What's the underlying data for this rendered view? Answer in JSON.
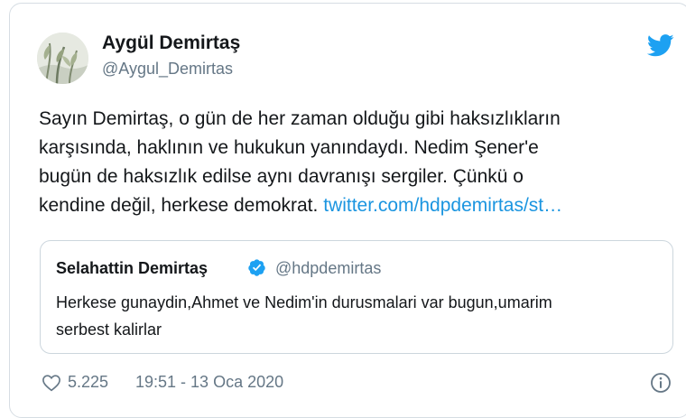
{
  "author": {
    "name": "Aygül Demirtaş",
    "handle": "@Aygul_Demirtas"
  },
  "tweet": {
    "lines": [
      "Sayın Demirtaş, o gün de her zaman olduğu gibi haksızlıkların",
      "karşısında, haklının ve hukukun yanındaydı. Nedim Şener'e",
      "bugün de haksızlık edilse aynı davranışı sergiler. Çünkü o",
      "kendine değil, herkese demokrat. "
    ],
    "link": "twitter.com/hdpdemirtas/st…"
  },
  "quoted_tweet": {
    "name": "Selahattin Demirtaş",
    "handle": "@hdpdemirtas",
    "lines": [
      "Herkese gunaydin,Ahmet ve Nedim'in durusmalari var bugun,umarim",
      "serbest kalirlar"
    ]
  },
  "footer": {
    "likes": "5.225",
    "timestamp": "19:51 - 13 Oca 2020"
  },
  "colors": {
    "brand": "#1da1f2",
    "link": "#1b95e0",
    "secondary_text": "#657786",
    "border": "#ccd6dd"
  },
  "icons": {
    "brand": "twitter-bird-icon",
    "verified": "verified-badge-icon",
    "like": "heart-icon",
    "info": "info-icon"
  }
}
